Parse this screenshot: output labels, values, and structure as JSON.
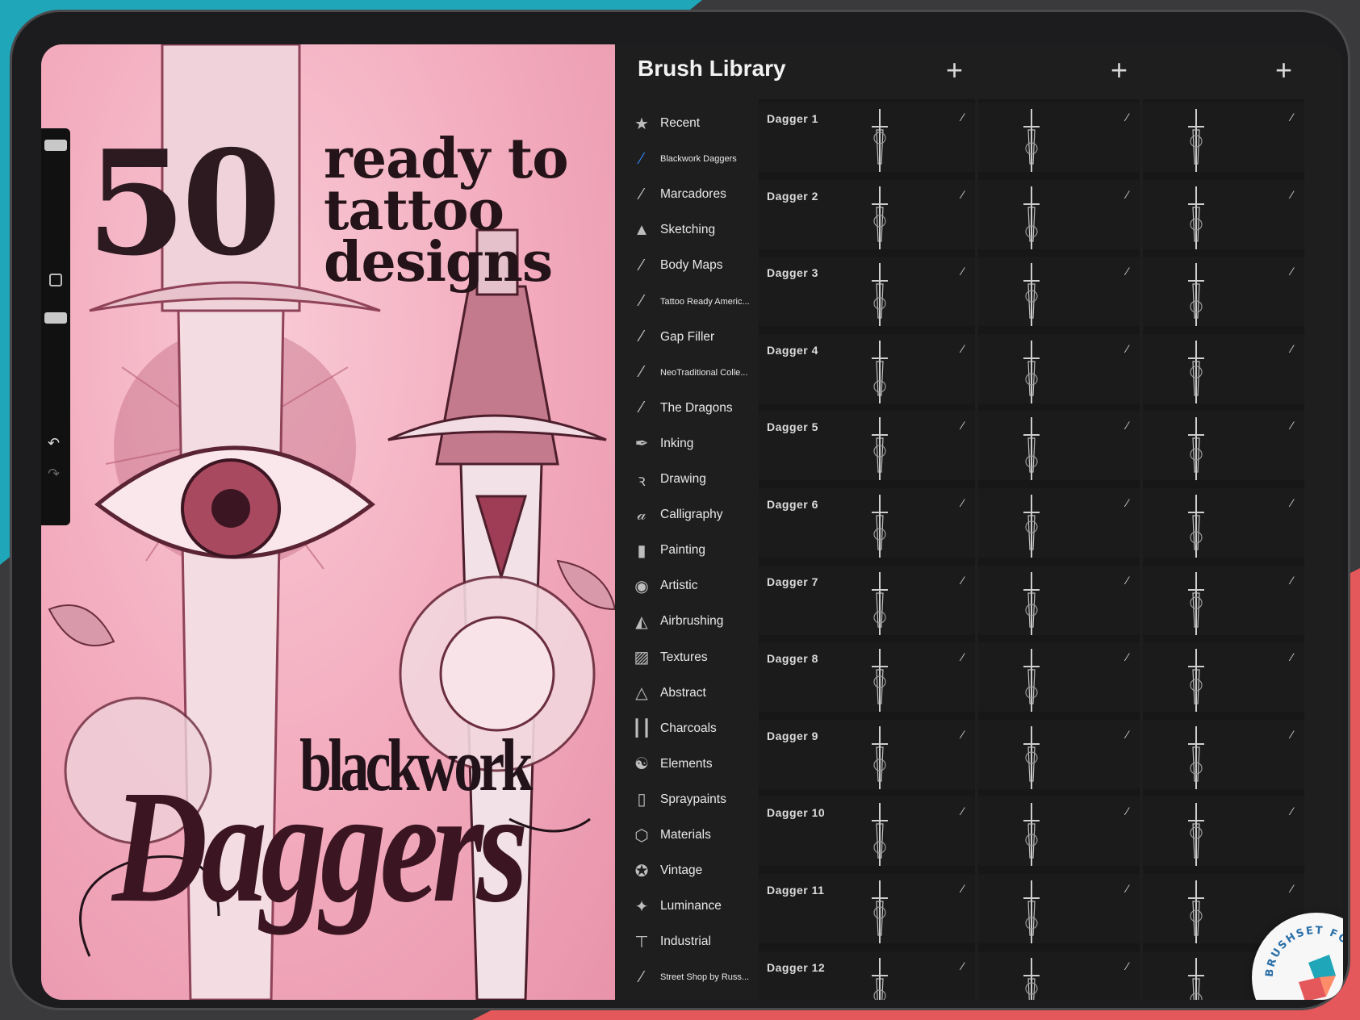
{
  "artwork": {
    "count": "50",
    "tagline": [
      "ready to",
      "tattoo",
      "designs"
    ],
    "title_small": "blackwork",
    "title_big": "Daggers"
  },
  "panel": {
    "title": "Brush Library",
    "add_icon": "plus-icon",
    "sets": [
      {
        "label": "Recent",
        "icon": "star-icon",
        "glyph": "★",
        "small": false,
        "active": false
      },
      {
        "label": "Blackwork Daggers",
        "icon": "brush-stroke-icon",
        "glyph": "⁄",
        "small": true,
        "active": true
      },
      {
        "label": "Marcadores",
        "icon": "brush-stroke-icon",
        "glyph": "⁄",
        "small": false,
        "active": false
      },
      {
        "label": "Sketching",
        "icon": "pencil-tip-icon",
        "glyph": "▲",
        "small": false,
        "active": false
      },
      {
        "label": "Body Maps",
        "icon": "brush-stroke-icon",
        "glyph": "⁄",
        "small": false,
        "active": false
      },
      {
        "label": "Tattoo Ready Americ...",
        "icon": "brush-stroke-icon",
        "glyph": "⁄",
        "small": true,
        "active": false
      },
      {
        "label": "Gap Filler",
        "icon": "brush-stroke-icon",
        "glyph": "⁄",
        "small": false,
        "active": false
      },
      {
        "label": "NeoTraditional  Colle...",
        "icon": "brush-stroke-icon",
        "glyph": "⁄",
        "small": true,
        "active": false
      },
      {
        "label": "The Dragons",
        "icon": "brush-stroke-icon",
        "glyph": "⁄",
        "small": false,
        "active": false
      },
      {
        "label": "Inking",
        "icon": "ink-nib-icon",
        "glyph": "✒",
        "small": false,
        "active": false
      },
      {
        "label": "Drawing",
        "icon": "squiggle-icon",
        "glyph": "ꝛ",
        "small": false,
        "active": false
      },
      {
        "label": "Calligraphy",
        "icon": "calligraphy-a-icon",
        "glyph": "𝒶",
        "small": false,
        "active": false
      },
      {
        "label": "Painting",
        "icon": "paintbrush-icon",
        "glyph": "▮",
        "small": false,
        "active": false
      },
      {
        "label": "Artistic",
        "icon": "palette-icon",
        "glyph": "◉",
        "small": false,
        "active": false
      },
      {
        "label": "Airbrushing",
        "icon": "airbrush-icon",
        "glyph": "◭",
        "small": false,
        "active": false
      },
      {
        "label": "Textures",
        "icon": "texture-icon",
        "glyph": "▨",
        "small": false,
        "active": false
      },
      {
        "label": "Abstract",
        "icon": "triangle-icon",
        "glyph": "△",
        "small": false,
        "active": false
      },
      {
        "label": "Charcoals",
        "icon": "charcoal-icon",
        "glyph": "┃┃",
        "small": false,
        "active": false
      },
      {
        "label": "Elements",
        "icon": "yin-yang-icon",
        "glyph": "☯",
        "small": false,
        "active": false
      },
      {
        "label": "Spraypaints",
        "icon": "spraycan-icon",
        "glyph": "▯",
        "small": false,
        "active": false
      },
      {
        "label": "Materials",
        "icon": "cube-icon",
        "glyph": "⬡",
        "small": false,
        "active": false
      },
      {
        "label": "Vintage",
        "icon": "star-circle-icon",
        "glyph": "✪",
        "small": false,
        "active": false
      },
      {
        "label": "Luminance",
        "icon": "sparkle-icon",
        "glyph": "✦",
        "small": false,
        "active": false
      },
      {
        "label": "Industrial",
        "icon": "anvil-icon",
        "glyph": "⊤",
        "small": false,
        "active": false
      },
      {
        "label": "Street Shop by Russ...",
        "icon": "brush-stroke-icon",
        "glyph": "⁄",
        "small": true,
        "active": false
      }
    ],
    "brushes": [
      "Dagger 1",
      "Dagger 2",
      "Dagger 3",
      "Dagger 4",
      "Dagger 5",
      "Dagger 6",
      "Dagger 7",
      "Dagger 8",
      "Dagger 9",
      "Dagger 10",
      "Dagger 11",
      "Dagger 12"
    ]
  },
  "side_controls": {
    "undo_icon": "undo-icon",
    "redo_icon": "redo-icon",
    "modify_icon": "square-icon"
  },
  "badge": {
    "text": "BRUSHSET FOR IPAD ONLY"
  },
  "colors": {
    "teal": "#1fa6b8",
    "coral": "#e4575a",
    "pink": "#f2a9bc",
    "ink": "#2d1a20",
    "active_blue": "#2d7fe3"
  }
}
